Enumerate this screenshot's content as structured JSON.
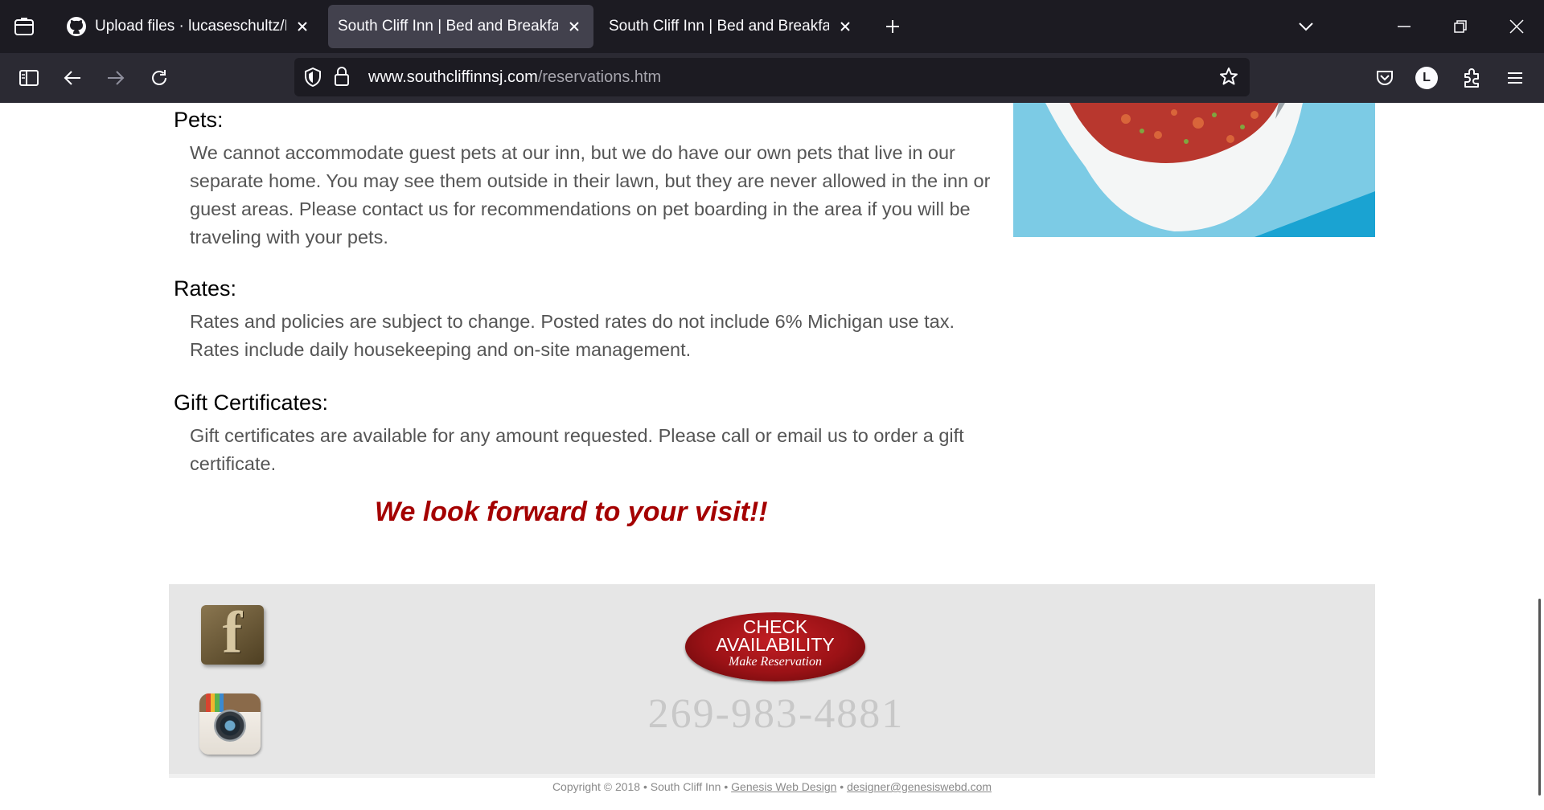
{
  "browser": {
    "tabs": [
      {
        "title": "Upload files · lucaseschultz/HTT",
        "icon": "github-icon",
        "active": false
      },
      {
        "title": "South Cliff Inn | Bed and Breakfast |",
        "active": true
      },
      {
        "title": "South Cliff Inn | Bed and Breakfast |",
        "active": false
      }
    ],
    "url_domain": "www.southcliffinnsj.com",
    "url_path": "/reservations.htm",
    "account_initial": "L"
  },
  "content": {
    "pets": {
      "heading": "Pets:",
      "body": "We cannot accommodate guest pets at our inn, but we do have our own pets that live in our separate home. You may see them outside in their lawn, but they are never allowed in the inn or guest areas. Please contact us for recommendations on pet boarding in the area if you will be traveling with your pets."
    },
    "rates": {
      "heading": "Rates:",
      "body": "Rates and policies are subject to change. Posted rates do not include 6% Michigan use tax. Rates include daily housekeeping and on-site management."
    },
    "gift": {
      "heading": "Gift Certificates:",
      "body": "Gift certificates are available for any amount requested. Please call or email us to order a gift certificate."
    },
    "closing": "We look forward to your visit!!"
  },
  "footer": {
    "check_line1": "CHECK",
    "check_line2": "AVAILABILITY",
    "check_line3": "Make Reservation",
    "phone": "269-983-4881",
    "facebook_letter": "f",
    "copyright_prefix": "Copyright © 2018 • South Cliff Inn •",
    "designer_link": "Genesis Web Design",
    "separator": "•",
    "designer_email": "designer@genesiswebd.com"
  }
}
